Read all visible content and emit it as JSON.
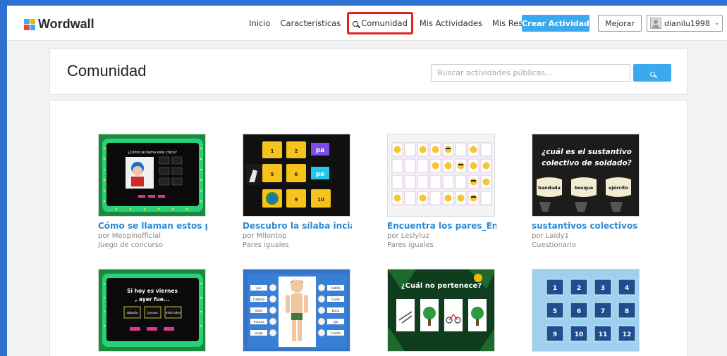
{
  "header": {
    "logo": "Wordwall",
    "nav": [
      {
        "label": "Inicio"
      },
      {
        "label": "Características"
      },
      {
        "label": "Comunidad",
        "active": true
      },
      {
        "label": "Mis Actividades"
      },
      {
        "label": "Mis Resultados"
      }
    ],
    "create_label": "Crear Actividad",
    "improve_label": "Mejorar",
    "username": "dianilu1998",
    "colors": {
      "accent": "#3aa9ef",
      "highlight": "#e02222",
      "frame": "#2e6fd2"
    }
  },
  "community": {
    "title": "Comunidad",
    "search_placeholder": "Buscar actividades públicas...",
    "search_value": ""
  },
  "activities": [
    {
      "title": "Cómo se llaman estos p...",
      "author": "por Meopinofficial",
      "type": "Juego de concurso",
      "thumb": "game-show-quiz"
    },
    {
      "title": "Descubro la sílaba incial...",
      "author": "por Mllontop",
      "type": "Pares iguales",
      "thumb": "matching-pairs-syllables"
    },
    {
      "title": "Encuentra los pares_Em...",
      "author": "por Leslyluz",
      "type": "Pares iguales",
      "thumb": "matching-pairs-emoji"
    },
    {
      "title": "sustantivos colectivos",
      "author": "por Laidy1",
      "type": "Cuestionario",
      "thumb": "quiz-collective-nouns"
    },
    {
      "title": "",
      "author": "",
      "type": "",
      "thumb": "game-show-days"
    },
    {
      "title": "",
      "author": "",
      "type": "",
      "thumb": "labelled-body-parts"
    },
    {
      "title": "",
      "author": "",
      "type": "",
      "thumb": "odd-one-out"
    },
    {
      "title": "",
      "author": "",
      "type": "",
      "thumb": "numbered-boxes"
    }
  ],
  "thumb_text": {
    "t1_heading": "¿Cómo se llama este chico?",
    "t2_tiles": [
      "1",
      "2",
      "pa",
      "5",
      "6",
      "pe",
      "9",
      "10"
    ],
    "t4_question": "¿cuál es el sustantivo colectivo de soldado?",
    "t4_options": [
      "bandada",
      "bosque",
      "ejército"
    ],
    "t5_question": "Si hoy es viernes , ayer fue...",
    "t5_options": [
      "sábado",
      "jueves",
      "miércoles"
    ],
    "t6_left": [
      "pie",
      "Cabeza",
      "nariz",
      "manos",
      "oreja"
    ],
    "t6_right": [
      "rodilla",
      "Codo",
      "boca",
      "ojo",
      "Cuello"
    ],
    "t7_question": "¿Cuál no pertenece?",
    "t8_numbers": [
      "1",
      "2",
      "3",
      "4",
      "5",
      "6",
      "7",
      "8",
      "9",
      "10",
      "11",
      "12"
    ]
  }
}
